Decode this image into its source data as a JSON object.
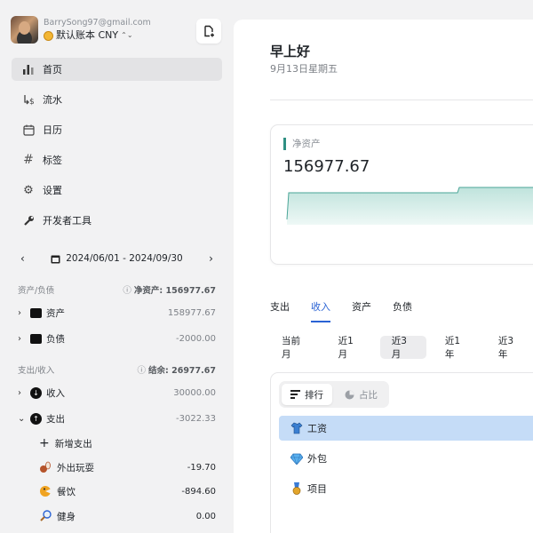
{
  "account": {
    "email": "BarrySong97@gmail.com",
    "book": "默认账本 CNY"
  },
  "nav": [
    {
      "label": "首页",
      "icon": "bar-chart-icon",
      "active": true
    },
    {
      "label": "流水",
      "icon": "transfer-icon",
      "active": false
    },
    {
      "label": "日历",
      "icon": "calendar-icon",
      "active": false
    },
    {
      "label": "标签",
      "icon": "hashtag-icon",
      "active": false
    },
    {
      "label": "设置",
      "icon": "gear-icon",
      "active": false
    },
    {
      "label": "开发者工具",
      "icon": "wrench-icon",
      "active": false
    }
  ],
  "date_range": "2024/06/01 - 2024/09/30",
  "assets_section": {
    "title": "资产/负债",
    "net_label": "净资产: 156977.67",
    "rows": [
      {
        "label": "资产",
        "amount": "158977.67"
      },
      {
        "label": "负债",
        "amount": "-2000.00"
      }
    ]
  },
  "flow_section": {
    "title": "支出/收入",
    "balance_label": "结余: 26977.67",
    "rows": [
      {
        "label": "收入",
        "amount": "30000.00"
      },
      {
        "label": "支出",
        "amount": "-3022.33"
      }
    ],
    "add_label": "新增支出",
    "sub_rows": [
      {
        "label": "外出玩耍",
        "amount": "-19.70"
      },
      {
        "label": "餐饮",
        "amount": "-894.60"
      },
      {
        "label": "健身",
        "amount": "0.00"
      }
    ]
  },
  "main": {
    "greeting": "早上好",
    "date": "9月13日星期五",
    "net_assets_label": "净资产",
    "net_assets_value": "156977.67",
    "tabs": [
      "支出",
      "收入",
      "资产",
      "负债"
    ],
    "active_tab": "收入",
    "ranges": [
      "当前月",
      "近1月",
      "近3月",
      "近1年",
      "近3年"
    ],
    "active_range": "近3月",
    "segments": [
      "排行",
      "占比"
    ],
    "active_segment": "排行",
    "rank_items": [
      {
        "label": "工资",
        "icon": "shirt-icon"
      },
      {
        "label": "外包",
        "icon": "gem-icon"
      },
      {
        "label": "项目",
        "icon": "medal-icon"
      }
    ]
  },
  "colors": {
    "accent": "#2a63d4",
    "teal": "#2f8f83",
    "selected_row": "#c5dcf7"
  }
}
